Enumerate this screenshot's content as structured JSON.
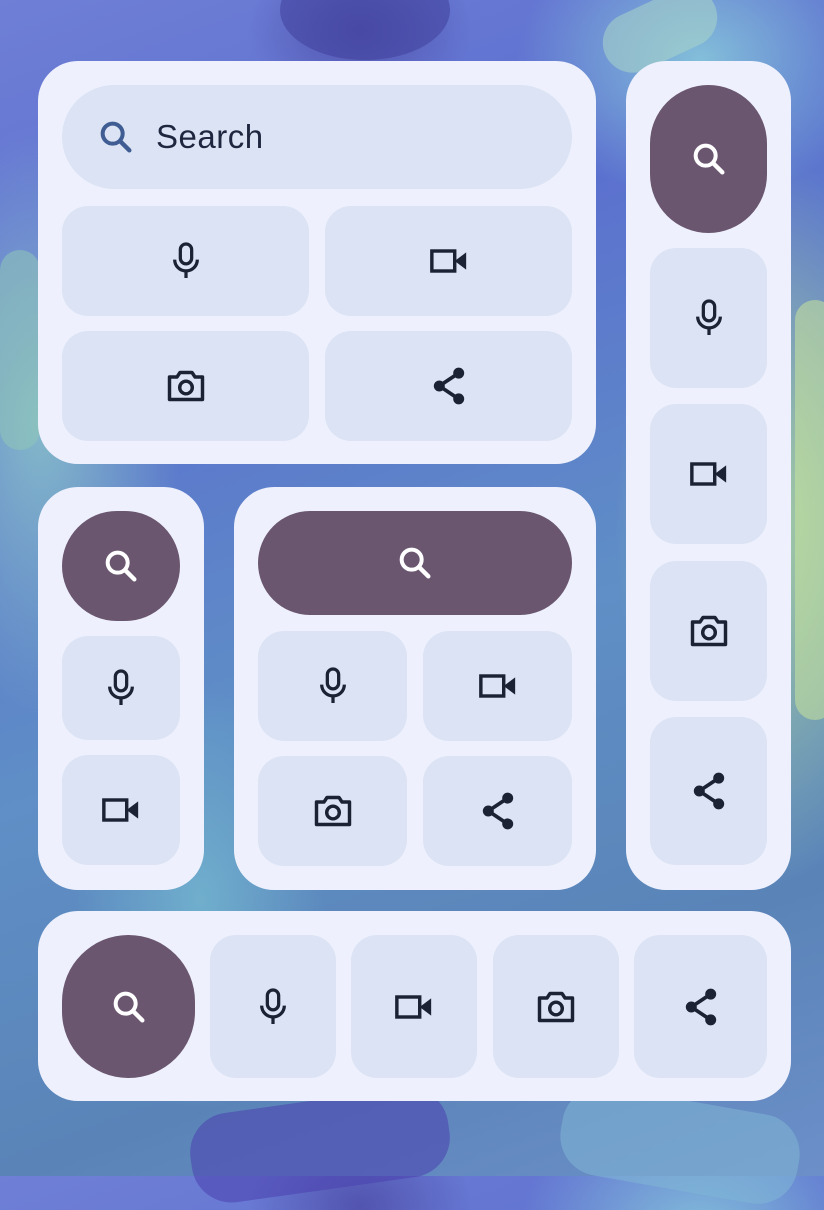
{
  "theme": {
    "panel_bg": "#eef1fd",
    "tile_bg": "#dbe3f4",
    "primary_bg": "#6b5670",
    "icon_color": "#1b2234"
  },
  "widget_large": {
    "search_label": "Search",
    "buttons": [
      "mic-icon",
      "videocam-icon",
      "camera-icon",
      "share-icon"
    ]
  },
  "widget_tall": {
    "buttons": [
      "search-icon",
      "mic-icon",
      "videocam-icon",
      "camera-icon",
      "share-icon"
    ]
  },
  "widget_small_column": {
    "buttons": [
      "search-icon",
      "mic-icon",
      "videocam-icon"
    ]
  },
  "widget_medium": {
    "buttons": [
      "search-icon",
      "mic-icon",
      "videocam-icon",
      "camera-icon",
      "share-icon"
    ]
  },
  "widget_row": {
    "buttons": [
      "search-icon",
      "mic-icon",
      "videocam-icon",
      "camera-icon",
      "share-icon"
    ]
  }
}
